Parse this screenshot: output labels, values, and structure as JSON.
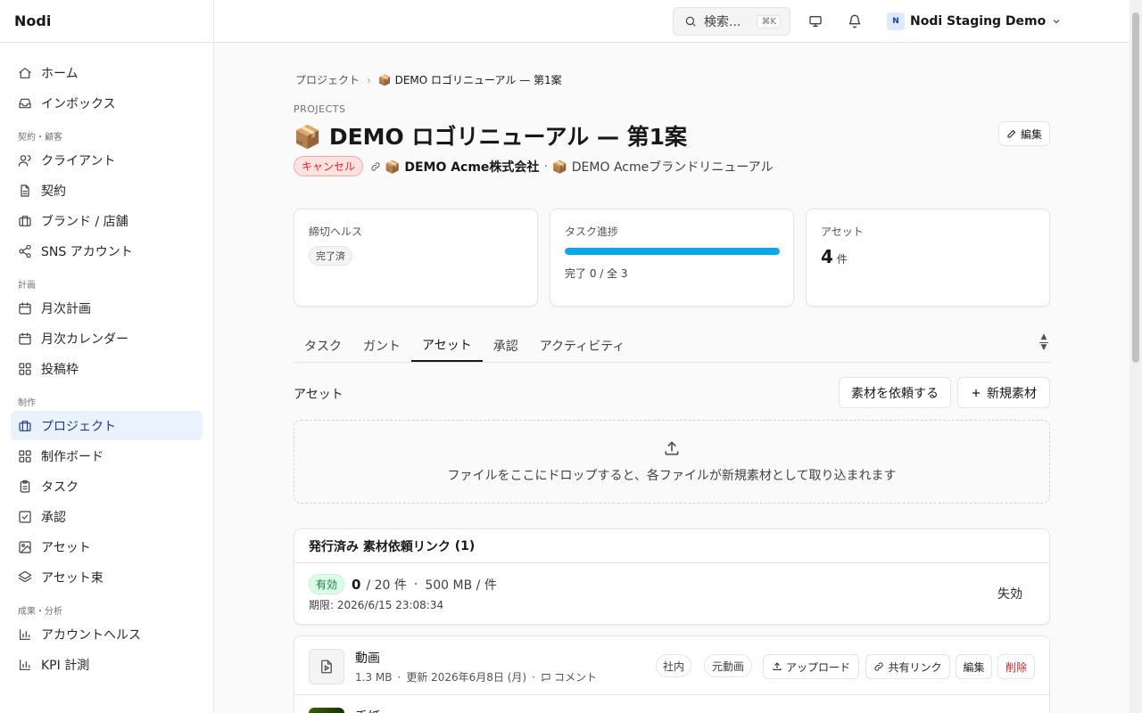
{
  "app": {
    "name": "Nodi"
  },
  "sidebar": {
    "items_top": [
      {
        "label": "ホーム",
        "icon": "home-icon"
      },
      {
        "label": "インボックス",
        "icon": "inbox-icon"
      }
    ],
    "sections": [
      {
        "label": "契約・顧客",
        "items": [
          {
            "label": "クライアント",
            "icon": "users-icon"
          },
          {
            "label": "契約",
            "icon": "file-icon"
          },
          {
            "label": "ブランド / 店舗",
            "icon": "briefcase-icon"
          },
          {
            "label": "SNS アカウント",
            "icon": "share-icon"
          }
        ]
      },
      {
        "label": "計画",
        "items": [
          {
            "label": "月次計画",
            "icon": "calendar-icon"
          },
          {
            "label": "月次カレンダー",
            "icon": "calendar-icon"
          },
          {
            "label": "投稿枠",
            "icon": "grid-icon"
          }
        ]
      },
      {
        "label": "制作",
        "items": [
          {
            "label": "プロジェクト",
            "icon": "briefcase-icon",
            "active": true
          },
          {
            "label": "制作ボード",
            "icon": "grid-icon"
          },
          {
            "label": "タスク",
            "icon": "clipboard-icon"
          },
          {
            "label": "承認",
            "icon": "check-square-icon"
          },
          {
            "label": "アセット",
            "icon": "image-icon"
          },
          {
            "label": "アセット束",
            "icon": "layers-icon"
          }
        ]
      },
      {
        "label": "成果・分析",
        "items": [
          {
            "label": "アカウントヘルス",
            "icon": "bar-chart-icon"
          },
          {
            "label": "KPI 計測",
            "icon": "bar-chart-icon"
          }
        ]
      }
    ]
  },
  "topbar": {
    "search_label": "検索...",
    "search_shortcut": "⌘K",
    "org_initial": "N",
    "org_name": "Nodi Staging Demo"
  },
  "breadcrumb": {
    "root": "プロジェクト",
    "current": "📦 DEMO ロゴリニューアル — 第1案"
  },
  "page": {
    "kicker": "PROJECTS",
    "title": "📦 DEMO ロゴリニューアル — 第1案",
    "edit_label": "編集",
    "status": "キャンセル",
    "client": "📦 DEMO Acme株式会社",
    "separator": "·",
    "brand": "📦 DEMO Acmeブランドリニューアル"
  },
  "cards": {
    "deadline": {
      "label": "締切ヘルス",
      "value": "完了済"
    },
    "tasks": {
      "label": "タスク進捗",
      "progress": 1.0,
      "text": "完了 0 / 全 3"
    },
    "assets": {
      "label": "アセット",
      "count": "4",
      "unit": "件"
    }
  },
  "tabs": [
    "タスク",
    "ガント",
    "アセット",
    "承認",
    "アクティビティ"
  ],
  "active_tab": 2,
  "assets_section": {
    "heading": "アセット",
    "request_button": "素材を依頼する",
    "new_button": "新規素材",
    "dropzone_text": "ファイルをここにドロップすると、各ファイルが新規素材として取り込まれます"
  },
  "request_links": {
    "header": "発行済み 素材依頼リンク",
    "count": "(1)",
    "link": {
      "status": "有効",
      "used": "0",
      "limit": "/ 20 件",
      "dot": "·",
      "size": "500 MB / 件",
      "expires": "期限: 2026/6/15 23:08:34",
      "action": "失効"
    }
  },
  "asset_rows": [
    {
      "name": "動画",
      "size": "1.3 MB",
      "dot": "·",
      "updated": "更新 2026年6月8日 (月)",
      "comment": "コメント",
      "tags": [
        "社内",
        "元動画"
      ],
      "actions": {
        "upload": "アップロード",
        "share": "共有リンク",
        "edit": "編集",
        "delete": "削除"
      }
    },
    {
      "name": "手紙"
    }
  ],
  "colors": {
    "accent": "#0ea5e9",
    "active_nav_bg": "#eaf3fd",
    "danger": "#dc2626",
    "success": "#15803d"
  }
}
